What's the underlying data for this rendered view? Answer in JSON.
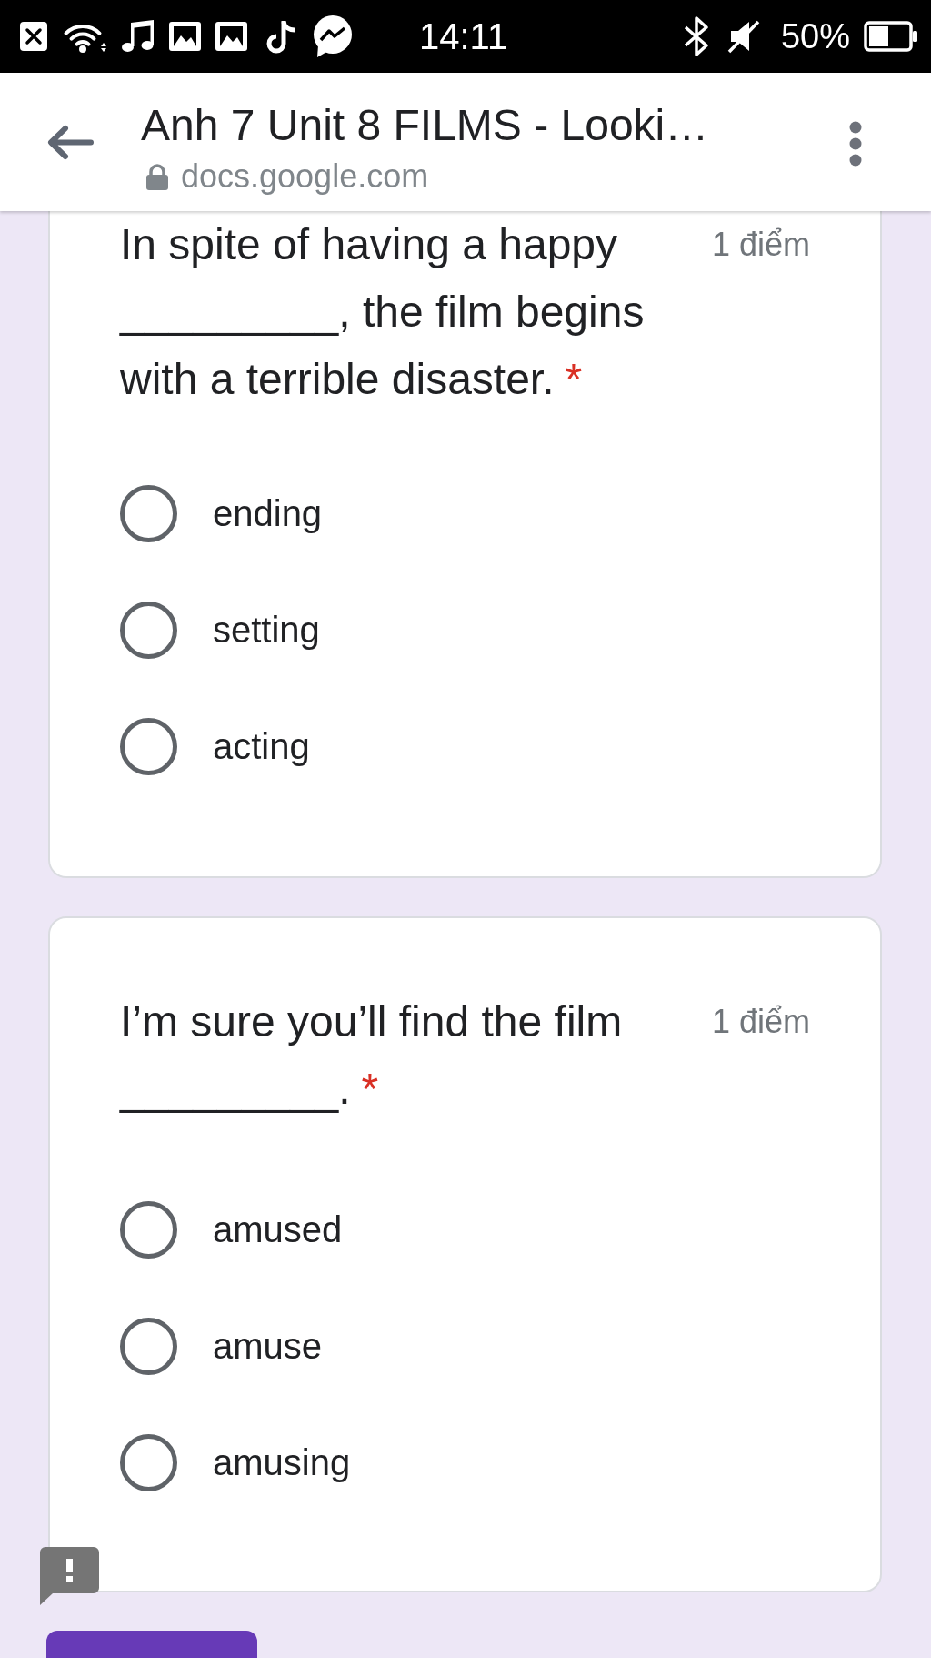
{
  "status_bar": {
    "time": "14:11",
    "battery": "50%"
  },
  "header": {
    "title": "Anh 7 Unit 8 FILMS - Looki…",
    "url": "docs.google.com"
  },
  "questions": [
    {
      "text": "In spite of having a happy _________, the film begins with a terrible disaster.",
      "required_mark": "*",
      "points": "1 điểm",
      "options": [
        {
          "label": "ending",
          "selected": false
        },
        {
          "label": "setting",
          "selected": false
        },
        {
          "label": "acting",
          "selected": false
        }
      ]
    },
    {
      "text": "I’m sure you’ll find the film _________.",
      "required_mark": "*",
      "points": "1 điểm",
      "options": [
        {
          "label": "amused",
          "selected": false
        },
        {
          "label": "amuse",
          "selected": false
        },
        {
          "label": "amusing",
          "selected": false
        }
      ]
    }
  ]
}
